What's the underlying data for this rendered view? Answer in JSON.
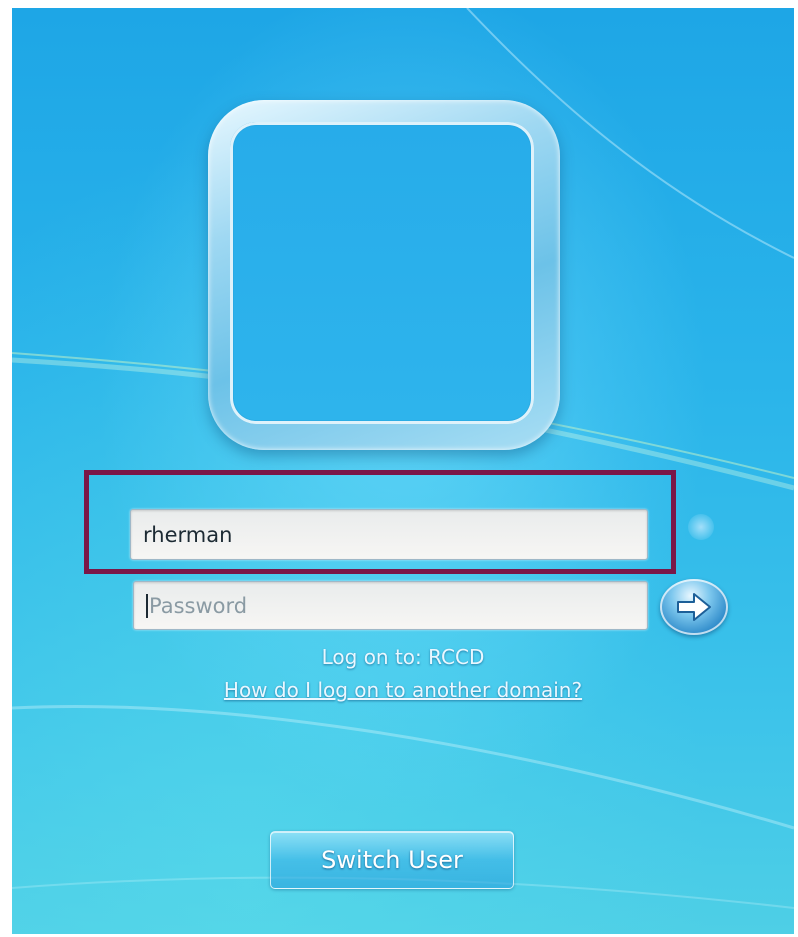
{
  "login": {
    "username_value": "rherman",
    "password_placeholder": "Password",
    "logon_to_text": "Log on to: RCCD",
    "other_domain_link": "How do I log on to another domain?",
    "switch_user_label": "Switch User"
  },
  "icons": {
    "submit": "arrow-right-icon"
  },
  "colors": {
    "background": "#2ab4ea",
    "highlight_border": "#7a1748",
    "text": "#eaf7ff"
  }
}
